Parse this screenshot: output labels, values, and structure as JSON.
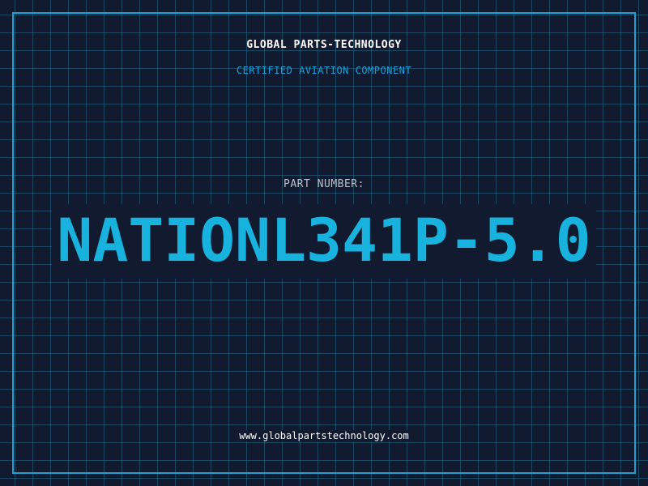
{
  "header": {
    "company": "GLOBAL PARTS-TECHNOLOGY",
    "tagline": "CERTIFIED AVIATION COMPONENT"
  },
  "part": {
    "label": "PART NUMBER:",
    "number": "NATIONL341P-5.0"
  },
  "footer": {
    "url": "www.globalpartstechnology.com"
  },
  "colors": {
    "background": "#111a2e",
    "grid": "#206e8c",
    "frame": "#1e9fd0",
    "accent": "#17b3de",
    "label": "#b9c2cc",
    "text": "#ffffff"
  }
}
